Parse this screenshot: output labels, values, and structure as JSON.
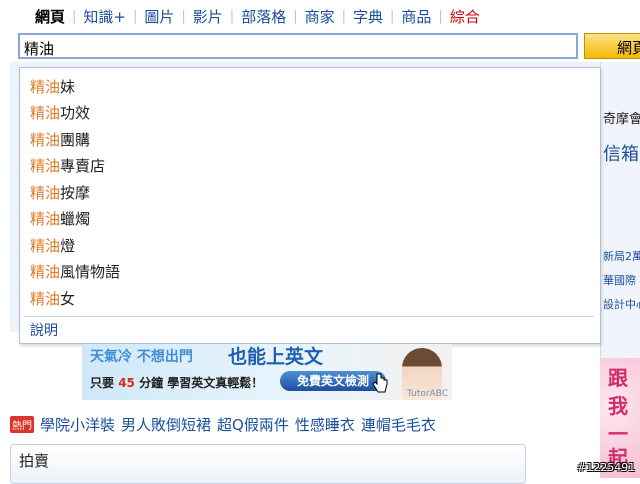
{
  "tabs": [
    {
      "label": "網頁"
    },
    {
      "label": "知識+"
    },
    {
      "label": "圖片"
    },
    {
      "label": "影片"
    },
    {
      "label": "部落格"
    },
    {
      "label": "商家"
    },
    {
      "label": "字典"
    },
    {
      "label": "商品"
    },
    {
      "label": "綜合"
    }
  ],
  "search": {
    "value": "精油",
    "button_label": "網頁"
  },
  "suggestions": {
    "prefix": "精油",
    "items": [
      {
        "rest": "妹"
      },
      {
        "rest": "功效"
      },
      {
        "rest": "團購"
      },
      {
        "rest": "專賣店"
      },
      {
        "rest": "按摩"
      },
      {
        "rest": "蠟燭"
      },
      {
        "rest": "燈"
      },
      {
        "rest": "風情物語"
      },
      {
        "rest": "女"
      }
    ],
    "help_label": "說明"
  },
  "right_strip": {
    "text1": "奇摩會",
    "text2": "信箱",
    "text3": "新局2萬",
    "text4": "華國際",
    "text5": "設計中心"
  },
  "ad": {
    "headline": "天氣冷  不想出門",
    "headline_big": "也能上英文",
    "sub_pre": "只要 ",
    "sub_num": "45",
    "sub_post": " 分鐘   學習英文真輕鬆！",
    "button": "免費英文檢測",
    "brand": "TutorABC"
  },
  "hot": {
    "badge": "熱門",
    "links": [
      {
        "label": "學院小洋裝"
      },
      {
        "label": "男人敗倒短裙"
      },
      {
        "label": "超Q假兩件"
      },
      {
        "label": "性感睡衣"
      },
      {
        "label": "連帽毛毛衣"
      }
    ]
  },
  "auction": {
    "title": "拍賣"
  },
  "pink_banner": {
    "c1": "跟",
    "c2": "我",
    "c3": "一",
    "c4": "起"
  },
  "watermark": "#1225491",
  "colors": {
    "link": "#1b4f9c",
    "highlight": "#e07b29",
    "accent_red": "#cc0000"
  }
}
